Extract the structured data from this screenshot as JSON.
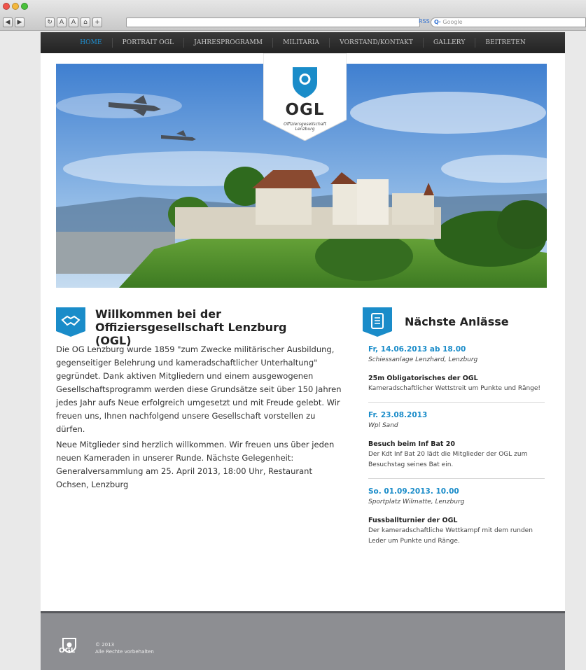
{
  "browser": {
    "rss_label": "RSS",
    "search_prefix": "Q·",
    "search_placeholder": "Google"
  },
  "nav": {
    "items": [
      {
        "label": "Home",
        "active": true
      },
      {
        "label": "Portrait OGL"
      },
      {
        "label": "Jahresprogramm"
      },
      {
        "label": "Militaria"
      },
      {
        "label": "Vorstand/Kontakt"
      },
      {
        "label": "Gallery"
      },
      {
        "label": "Beitreten"
      }
    ]
  },
  "logo": {
    "title": "OGL",
    "subtitle_line1": "Offiziersgesellschaft",
    "subtitle_line2": "Lenzburg"
  },
  "colors": {
    "accent": "#1a8cc9",
    "nav_bg": "#2b2b2b",
    "footer_bg": "#8d8e92"
  },
  "welcome": {
    "icon": "handshake-icon",
    "title_line1": "Willkommen bei der",
    "title_line2": "Offiziersgesellschaft Lenzburg (OGL)",
    "paragraph1": "Die OG Lenzburg wurde 1859 \"zum Zwecke militärischer Ausbildung, gegenseitiger Belehrung und kameradschaftlicher Unterhaltung\" gegründet. Dank aktiven Mitgliedern und einem ausgewogenen Gesellschaftsprogramm werden diese Grundsätze seit über 150 Jahren jedes Jahr aufs Neue erfolgreich umgesetzt und mit Freude gelebt. Wir freuen uns, Ihnen nachfolgend unsere Gesellschaft vorstellen zu dürfen.",
    "paragraph2": "Neue Mitglieder sind herzlich willkommen. Wir freuen uns über jeden neuen Kameraden in unserer Runde. Nächste Gelegenheit: Generalversammlung am 25. April 2013, 18:00 Uhr, Restaurant Ochsen, Lenzburg"
  },
  "events": {
    "icon": "document-icon",
    "title": "Nächste Anlässe",
    "items": [
      {
        "date": "Fr, 14.06.2013 ab 18.00",
        "place": "Schiessanlage Lenzhard, Lenzburg",
        "title": "25m Obligatorisches der OGL",
        "desc": "Kameradschaftlicher Wettstreit um Punkte und Ränge!"
      },
      {
        "date": "Fr. 23.08.2013",
        "place": "Wpl Sand",
        "title": "Besuch beim Inf Bat 20",
        "desc": "Der Kdt Inf Bat 20 lädt die Mitglieder der OGL zum Besuchstag seines Bat ein."
      },
      {
        "date": "So. 01.09.2013. 10.00",
        "place": "Sportplatz Wilmatte, Lenzburg",
        "title": "Fussballturnier der OGL",
        "desc": "Der kameradschaftliche Wettkampf mit dem runden Leder um Punkte und Ränge."
      }
    ]
  },
  "footer": {
    "logo_text": "OGL",
    "copyright": "© 2013",
    "rights": "Alle Rechte vorbehalten"
  }
}
